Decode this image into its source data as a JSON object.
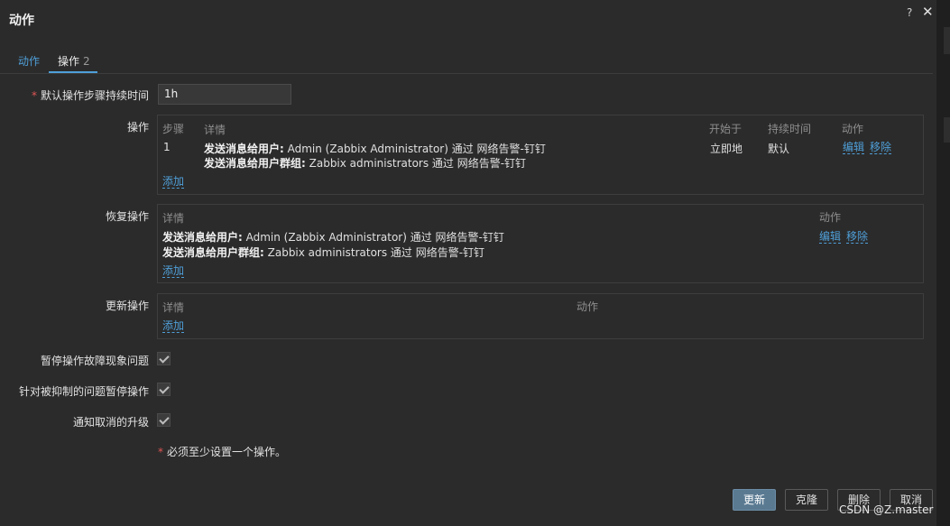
{
  "dialog": {
    "title": "动作"
  },
  "icons": {
    "help": "?",
    "close": "✕"
  },
  "tabs": [
    {
      "label": "动作"
    },
    {
      "label": "操作",
      "count": "2"
    }
  ],
  "fields": {
    "default_step_duration_label": "默认操作步骤持续时间",
    "default_step_duration_value": "1h",
    "operations_label": "操作",
    "recovery_label": "恢复操作",
    "update_label": "更新操作",
    "pause_symptoms_label": "暂停操作故障现象问题",
    "pause_suppressed_label": "针对被抑制的问题暂停操作",
    "notify_cancelled_label": "通知取消的升级"
  },
  "operations_table": {
    "headers": {
      "step": "步骤",
      "details": "详情",
      "start": "开始于",
      "duration": "持续时间",
      "action": "动作"
    },
    "row": {
      "step": "1",
      "line1_bold": "发送消息给用户:",
      "line1_rest": " Admin (Zabbix Administrator) 通过 网络告警-钉钉",
      "line2_bold": "发送消息给用户群组:",
      "line2_rest": " Zabbix administrators 通过 网络告警-钉钉",
      "start": "立即地",
      "duration": "默认",
      "edit": "编辑",
      "remove": "移除"
    },
    "add": "添加"
  },
  "recovery_table": {
    "headers": {
      "details": "详情",
      "action": "动作"
    },
    "row": {
      "line1_bold": "发送消息给用户:",
      "line1_rest": " Admin (Zabbix Administrator) 通过 网络告警-钉钉",
      "line2_bold": "发送消息给用户群组:",
      "line2_rest": " Zabbix administrators 通过 网络告警-钉钉",
      "edit": "编辑",
      "remove": "移除"
    },
    "add": "添加"
  },
  "update_table": {
    "headers": {
      "details": "详情",
      "action": "动作"
    },
    "add": "添加"
  },
  "note": "必须至少设置一个操作。",
  "buttons": {
    "update": "更新",
    "clone": "克隆",
    "delete": "删除",
    "cancel": "取消"
  },
  "watermark": "CSDN @Z.master"
}
